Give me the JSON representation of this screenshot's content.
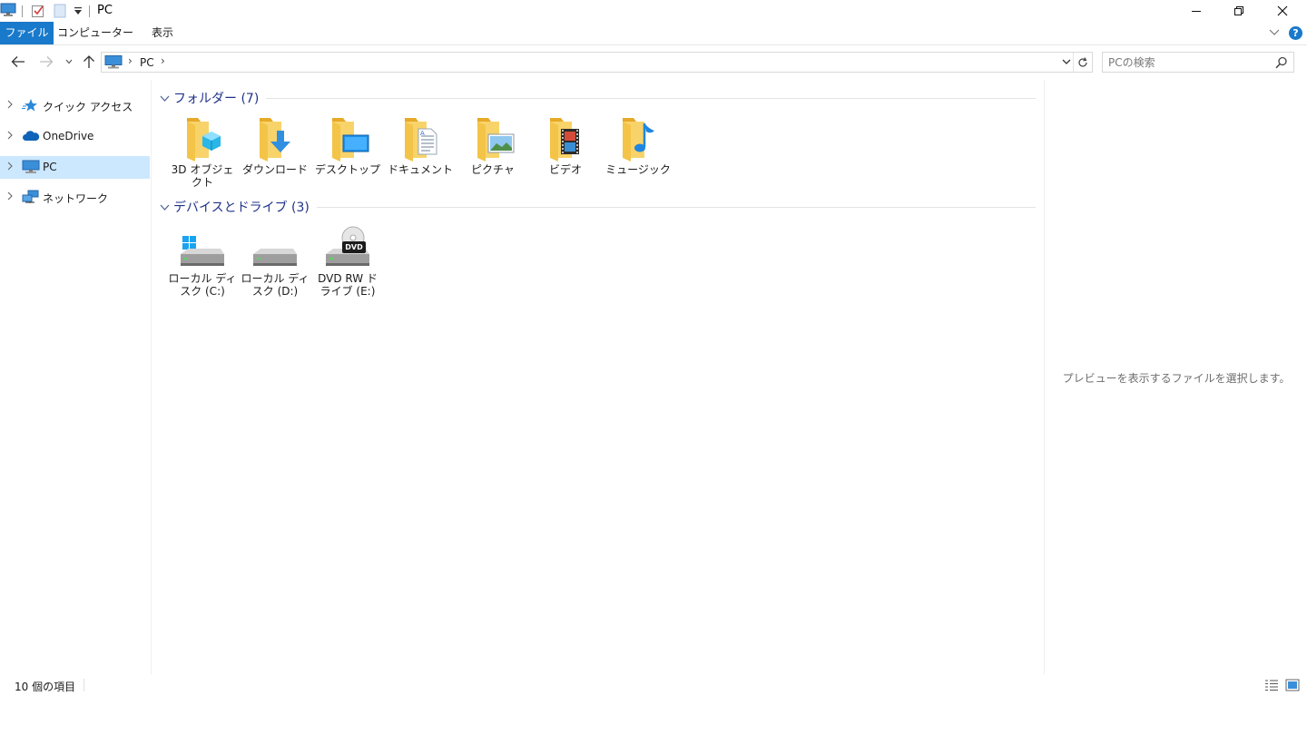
{
  "window": {
    "title": "PC",
    "controls": {
      "minimize": "minimize-icon",
      "restore": "restore-icon",
      "close": "close-icon"
    }
  },
  "ribbon": {
    "tabs": [
      {
        "label": "ファイル",
        "active": true
      },
      {
        "label": "コンピューター"
      },
      {
        "label": "表示"
      }
    ],
    "help_label": "?"
  },
  "address": {
    "crumb": "PC",
    "search_placeholder": "PCの検索"
  },
  "nav": {
    "items": [
      {
        "label": "クイック アクセス",
        "icon": "star-icon"
      },
      {
        "label": "OneDrive",
        "icon": "cloud-icon"
      },
      {
        "label": "PC",
        "icon": "computer-icon",
        "selected": true
      },
      {
        "label": "ネットワーク",
        "icon": "network-icon"
      }
    ]
  },
  "groups": {
    "folders": {
      "title": "フォルダー (7)",
      "items": [
        {
          "label": "3D オブジェクト",
          "icon": "3d-objects-folder-icon"
        },
        {
          "label": "ダウンロード",
          "icon": "downloads-folder-icon"
        },
        {
          "label": "デスクトップ",
          "icon": "desktop-folder-icon"
        },
        {
          "label": "ドキュメント",
          "icon": "documents-folder-icon"
        },
        {
          "label": "ピクチャ",
          "icon": "pictures-folder-icon"
        },
        {
          "label": "ビデオ",
          "icon": "videos-folder-icon"
        },
        {
          "label": "ミュージック",
          "icon": "music-folder-icon"
        }
      ]
    },
    "drives": {
      "title": "デバイスとドライブ (3)",
      "items": [
        {
          "label": "ローカル ディスク (C:)",
          "icon": "windows-drive-icon"
        },
        {
          "label": "ローカル ディスク (D:)",
          "icon": "hard-drive-icon"
        },
        {
          "label": "DVD RW ドライブ (E:)",
          "icon": "dvd-drive-icon",
          "badge": "DVD"
        }
      ]
    }
  },
  "preview": {
    "message": "プレビューを表示するファイルを選択します。"
  },
  "status": {
    "count": "10 個の項目"
  },
  "colors": {
    "accent": "#1979ca",
    "selection": "#cce8ff",
    "group_title": "#1e3287",
    "folder": "#f5c54b"
  }
}
